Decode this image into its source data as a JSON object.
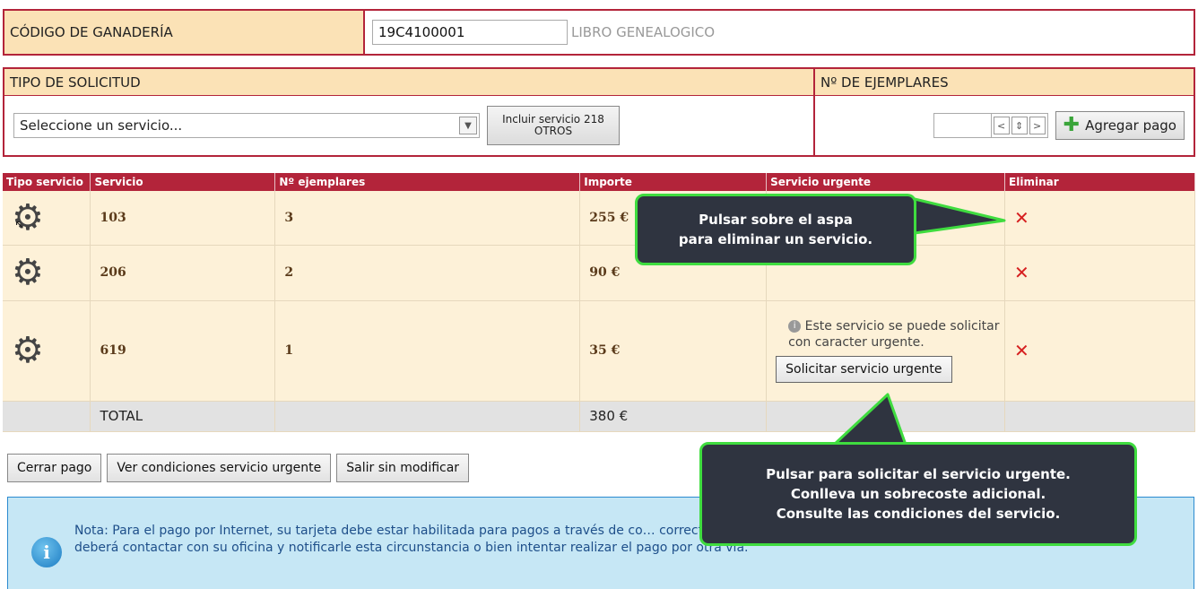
{
  "codigo": {
    "label": "CÓDIGO DE GANADERÍA",
    "value": "19C4100001",
    "libro": "LIBRO GENEALOGICO"
  },
  "solicitud": {
    "tipo_header": "TIPO DE SOLICITUD",
    "ejemplares_header": "Nº DE EJEMPLARES",
    "select_value": "Seleccione un servicio...",
    "incluir_line1": "Incluir servicio 218",
    "incluir_line2": "OTROS",
    "spin_prev": "<",
    "spin_updown": "⇕",
    "spin_next": ">",
    "agregar_label": "Agregar pago"
  },
  "table": {
    "headers": [
      "Tipo servicio",
      "Servicio",
      "Nº ejemplares",
      "Importe",
      "Servicio urgente",
      "Eliminar"
    ],
    "rows": [
      {
        "servicio": "103",
        "ejemplares": "3",
        "importe": "255 €"
      },
      {
        "servicio": "206",
        "ejemplares": "2",
        "importe": "90 €"
      },
      {
        "servicio": "619",
        "ejemplares": "1",
        "importe": "35 €"
      }
    ],
    "urgent_text": "Este servicio se puede solicitar con caracter urgente.",
    "urgent_button": "Solicitar servicio urgente",
    "total_label": "TOTAL",
    "total_value": "380 €"
  },
  "buttons": {
    "cerrar": "Cerrar pago",
    "ver_condiciones": "Ver condiciones servicio urgente",
    "salir": "Salir sin modificar"
  },
  "note": {
    "text": "Nota: Para el pago por Internet, su tarjeta debe estar habilitada para pagos a través de co… correctamente o le aparece un mensaje similar a PIN erróneo o bloqueado, deberá contactar con su oficina y notificarle esta circunstancia o bien intentar realizar el pago por otra vía."
  },
  "callouts": {
    "eliminar_line1": "Pulsar sobre el aspa",
    "eliminar_line2": "para eliminar un servicio.",
    "urgente_line1": "Pulsar para solicitar el servicio urgente.",
    "urgente_line2": "Conlleva un sobrecoste adicional.",
    "urgente_line3": "Consulte las condiciones del servicio."
  },
  "colors": {
    "brand_red": "#b3243a",
    "header_bg": "#fbe2b6",
    "row_bg": "#fdf1d8",
    "delete_x": "#d62020",
    "callout_bg": "#2f3440",
    "callout_border": "#3fdc3f",
    "note_bg": "#c6e7f5"
  },
  "icons": {
    "type": "gear-icon",
    "delete": "close-x-icon",
    "add": "plus-icon",
    "info": "info-icon"
  }
}
